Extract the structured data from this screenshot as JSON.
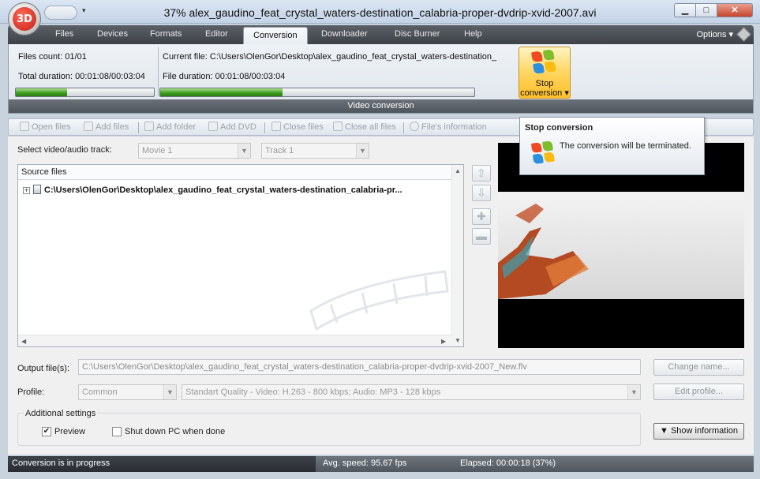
{
  "window": {
    "title": "37% alex_gaudino_feat_crystal_waters-destination_calabria-proper-dvdrip-xvid-2007.avi",
    "logo_text": "3D",
    "minimize": "▁",
    "maximize": "□",
    "close": "✕"
  },
  "tabs": [
    {
      "label": "Files"
    },
    {
      "label": "Devices"
    },
    {
      "label": "Formats"
    },
    {
      "label": "Editor"
    },
    {
      "label": "Conversion"
    },
    {
      "label": "Downloader"
    },
    {
      "label": "Disc Burner"
    },
    {
      "label": "Help"
    }
  ],
  "active_tab": "Conversion",
  "options_label": "Options ▾",
  "ribbon": {
    "files_count": "Files count: 01/01",
    "total_duration": "Total duration: 00:01:08/00:03:04",
    "current_file": "Current file: C:\\Users\\OlenGor\\Desktop\\alex_gaudino_feat_crystal_waters-destination_",
    "file_duration": "File duration: 00:01:08/00:03:04",
    "total_progress": 0.37,
    "file_progress": 0.39,
    "stop_button_line1": "Stop",
    "stop_button_line2": "conversion ▾",
    "group_label": "Video conversion"
  },
  "toolbar": {
    "open_files": "Open files",
    "add_files": "Add files",
    "add_folder": "Add folder",
    "add_dvd": "Add DVD",
    "close_files": "Close files",
    "close_all_files": "Close all files",
    "files_information": "File's information"
  },
  "track": {
    "label": "Select video/audio track:",
    "video_track": "Movie 1",
    "audio_track": "Track 1"
  },
  "source": {
    "header": "Source files",
    "file_path": "C:\\Users\\OlenGor\\Desktop\\alex_gaudino_feat_crystal_waters-destination_calabria-pr..."
  },
  "output": {
    "label": "Output file(s):",
    "value": "C:\\Users\\OlenGor\\Desktop\\alex_gaudino_feat_crystal_waters-destination_calabria-proper-dvdrip-xvid-2007_New.flv",
    "change_name": "Change name..."
  },
  "profile": {
    "label": "Profile:",
    "category": "Common",
    "quality": "Standart Quality - Video: H.263 - 800 kbps; Audio: MP3 - 128 kbps",
    "edit_profile": "Edit profile..."
  },
  "additional": {
    "title": "Additional settings",
    "preview_label": "Preview",
    "preview_checked": true,
    "shutdown_label": "Shut down PC when done",
    "shutdown_checked": false,
    "show_information": "▼ Show information"
  },
  "status": {
    "progress_text": "Conversion is in progress",
    "avg_speed": "Avg. speed: 95.67 fps",
    "elapsed": "Elapsed: 00:00:18 (37%)"
  },
  "tooltip": {
    "title": "Stop conversion",
    "text": "The conversion will be terminated."
  }
}
